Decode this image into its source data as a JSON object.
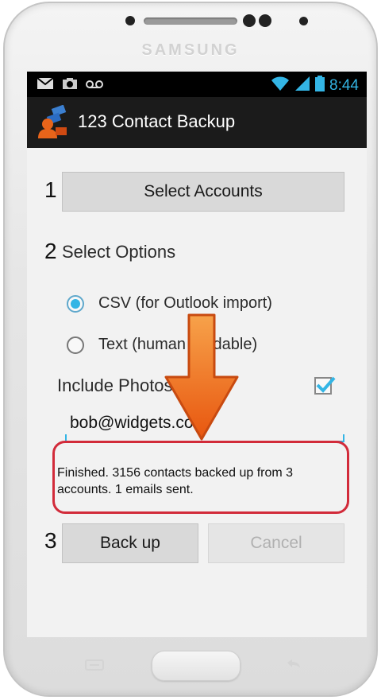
{
  "device": {
    "brand": "SAMSUNG"
  },
  "status_bar": {
    "time": "8:44"
  },
  "app": {
    "title": "123 Contact Backup"
  },
  "steps": {
    "one": "1",
    "two": "2",
    "three": "3"
  },
  "select_accounts_label": "Select Accounts",
  "select_options_label": "Select Options",
  "options": [
    {
      "label": "CSV (for Outlook import)",
      "selected": true
    },
    {
      "label": "Text (human readable)",
      "selected": false
    }
  ],
  "include_photos": {
    "label": "Include Photos",
    "checked": true
  },
  "email": {
    "value": "bob@widgets.com"
  },
  "status_message": "Finished. 3156 contacts backed up from 3 accounts. 1 emails sent.",
  "buttons": {
    "backup": "Back up",
    "cancel": "Cancel"
  },
  "colors": {
    "accent": "#33b5e5",
    "highlight_box": "#d22b3a",
    "arrow": "#f07a1e"
  }
}
